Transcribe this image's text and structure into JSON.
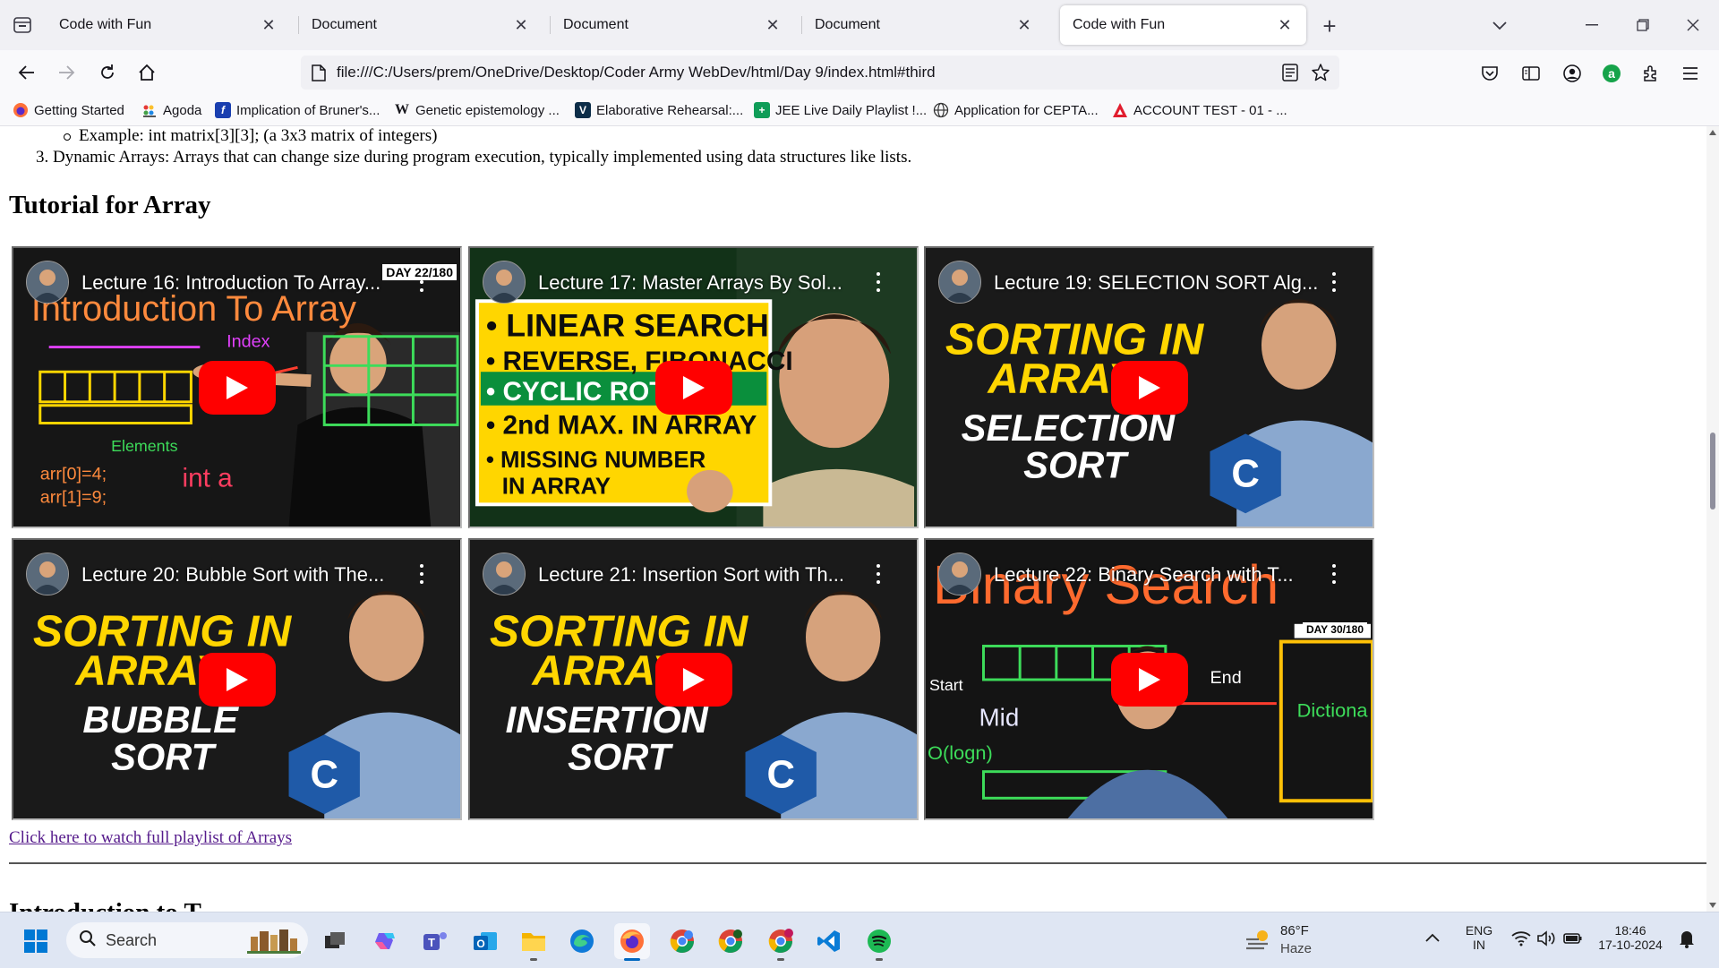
{
  "browser": {
    "tabs": [
      {
        "title": "Code with Fun",
        "active": false
      },
      {
        "title": "Document",
        "active": false
      },
      {
        "title": "Document",
        "active": false
      },
      {
        "title": "Document",
        "active": false
      },
      {
        "title": "Code with Fun",
        "active": true
      }
    ],
    "url": "file:///C:/Users/prem/OneDrive/Desktop/Coder Army WebDev/html/Day 9/index.html#third",
    "bookmarks": [
      {
        "label": "Getting Started",
        "icon": "firefox-icon"
      },
      {
        "label": "Agoda",
        "icon": "agoda-icon"
      },
      {
        "label": "Implication of Bruner's...",
        "icon": "document-icon"
      },
      {
        "label": "Genetic epistemology ...",
        "icon": "wikipedia-icon"
      },
      {
        "label": "Elaborative Rehearsal:...",
        "icon": "v-icon"
      },
      {
        "label": "JEE Live Daily Playlist !...",
        "icon": "sheets-icon"
      },
      {
        "label": "Application for CEPTA...",
        "icon": "globe-icon"
      },
      {
        "label": "ACCOUNT TEST - 01 - ...",
        "icon": "triangle-icon"
      }
    ]
  },
  "page": {
    "sub_item": "Example: int matrix[3][3]; (a 3x3 matrix of integers)",
    "item_3": "3. Dynamic Arrays: Arrays that can change size during program execution, typically implemented using data structures like lists.",
    "section_heading": "Tutorial for Array",
    "videos": [
      {
        "title": "Lecture 16: Introduction To Array...",
        "badge": "DAY 22/180",
        "thumb_text": [
          "Introduction To Array",
          "Index",
          "Elements",
          "arr[0]=4;",
          "arr[1]=9;",
          "int a"
        ]
      },
      {
        "title": "Lecture 17: Master Arrays By Sol...",
        "badge": "",
        "thumb_text": [
          "• LINEAR SEARCH",
          "• REVERSE, FIBONACCI",
          "• CYCLIC ROTAT",
          "• 2nd MAX. IN ARRAY",
          "• MISSING NUMBER",
          "IN ARRAY"
        ]
      },
      {
        "title": "Lecture 19: SELECTION SORT Alg...",
        "badge": "",
        "thumb_text": [
          "SORTING IN",
          "ARRAYS",
          "SELECTION",
          "SORT"
        ]
      },
      {
        "title": "Lecture 20: Bubble Sort with The...",
        "badge": "",
        "thumb_text": [
          "SORTING IN",
          "ARRAYS",
          "BUBBLE",
          "SORT"
        ]
      },
      {
        "title": "Lecture 21: Insertion Sort with Th...",
        "badge": "",
        "thumb_text": [
          "SORTING IN",
          "ARRAYS",
          "INSERTION",
          "SORT"
        ]
      },
      {
        "title": "Lecture 22: Binary Search with T...",
        "badge": "DAY 30/180",
        "thumb_text": [
          "Binary Search",
          "Start",
          "End",
          "Mid",
          "O(logn)",
          "Dictiona"
        ]
      }
    ],
    "playlist_link": "Click here to watch full playlist of Arrays",
    "next_heading": "Introduction to T"
  },
  "taskbar": {
    "search_placeholder": "Search",
    "weather_temp": "86°F",
    "weather_cond": "Haze",
    "lang_top": "ENG",
    "lang_bottom": "IN",
    "time": "18:46",
    "date": "17-10-2024"
  },
  "colors": {
    "tabbar_bg": "#f0f0f4",
    "link_visited": "#551a8b",
    "yt_red": "#ff0000",
    "taskbar_bg": "#dfe6f3"
  }
}
